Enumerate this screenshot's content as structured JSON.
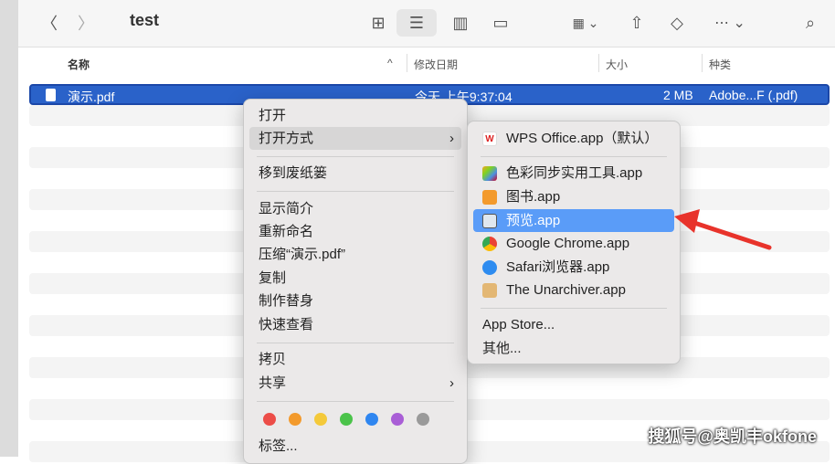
{
  "window": {
    "title": "test"
  },
  "columns": {
    "name": "名称",
    "date": "修改日期",
    "size": "大小",
    "kind": "种类"
  },
  "file": {
    "name": "演示.pdf",
    "date": "今天 上午9:37:04",
    "size": "2 MB",
    "kind": "Adobe...F (.pdf)"
  },
  "context_menu": {
    "items": [
      "打开",
      "打开方式",
      "移到废纸篓",
      "显示简介",
      "重新命名",
      "压缩“演示.pdf”",
      "复制",
      "制作替身",
      "快速查看",
      "拷贝",
      "共享",
      "标签..."
    ],
    "tag_colors": [
      "#ec4d48",
      "#f39a2c",
      "#f4c93a",
      "#4bc34a",
      "#2f86f0",
      "#a95ed6",
      "#9a9a9a"
    ]
  },
  "open_with": {
    "default": "WPS Office.app（默认）",
    "apps": [
      "色彩同步实用工具.app",
      "图书.app",
      "预览.app",
      "Google Chrome.app",
      "Safari浏览器.app",
      "The Unarchiver.app"
    ],
    "app_store": "App Store...",
    "other": "其他..."
  },
  "annotation": {
    "arrow_color": "#e8332b"
  },
  "watermark": "搜狐号@奥凯丰okfone"
}
